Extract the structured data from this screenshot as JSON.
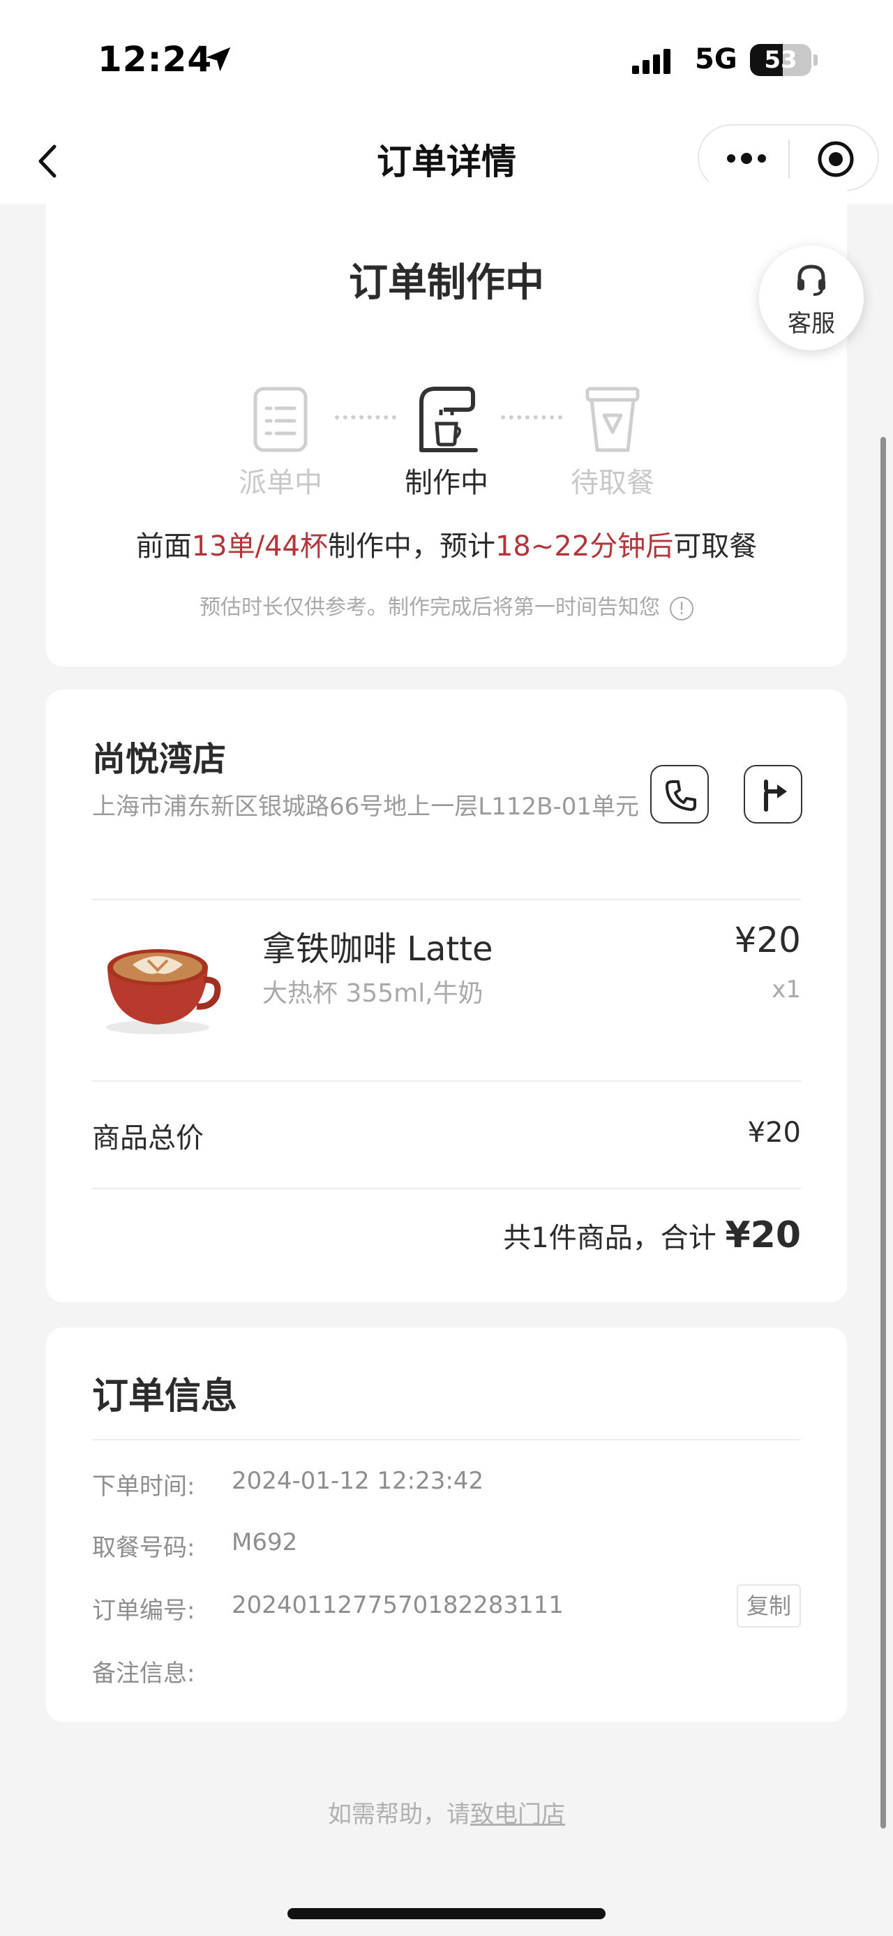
{
  "status_bar": {
    "time": "12:24",
    "network": "5G",
    "battery": "53",
    "battery_level": 0.53
  },
  "nav": {
    "title": "订单详情"
  },
  "order_status": {
    "title": "订单制作中",
    "steps": [
      {
        "label": "派单中",
        "active": false,
        "icon": "clipboard-icon"
      },
      {
        "label": "制作中",
        "active": true,
        "icon": "coffee-machine-icon"
      },
      {
        "label": "待取餐",
        "active": false,
        "icon": "cup-icon"
      }
    ],
    "queue": {
      "prefix": "前面",
      "orders": "13单/44杯",
      "middle": "制作中，预计",
      "eta": "18~22分钟后",
      "suffix": "可取餐"
    },
    "note": "预估时长仅供参考。制作完成后将第一时间告知您",
    "service_label": "客服"
  },
  "store": {
    "name": "尚悦湾店",
    "address": "上海市浦东新区银城路66号地上一层L112B-01单元",
    "product": {
      "name": "拿铁咖啡 Latte",
      "spec": "大热杯 355ml,牛奶",
      "price": "¥20",
      "qty": "x1",
      "image": "latte-cup-image"
    },
    "subtotal_label": "商品总价",
    "subtotal_value": "¥20",
    "total_prefix": "共1件商品，合计",
    "total_value": "¥20"
  },
  "order_info": {
    "title": "订单信息",
    "rows": [
      {
        "label": "下单时间:",
        "value": "2024-01-12 12:23:42"
      },
      {
        "label": "取餐号码:",
        "value": "M692"
      },
      {
        "label": "订单编号:",
        "value": "20240112775701822831​11"
      },
      {
        "label": "备注信息:",
        "value": ""
      }
    ],
    "copy_label": "复制"
  },
  "help": {
    "prefix": "如需帮助，请",
    "link": "致电门店"
  },
  "colors": {
    "accent": "#b0363a",
    "card": "#ffffff",
    "background": "#f4f4f4"
  }
}
